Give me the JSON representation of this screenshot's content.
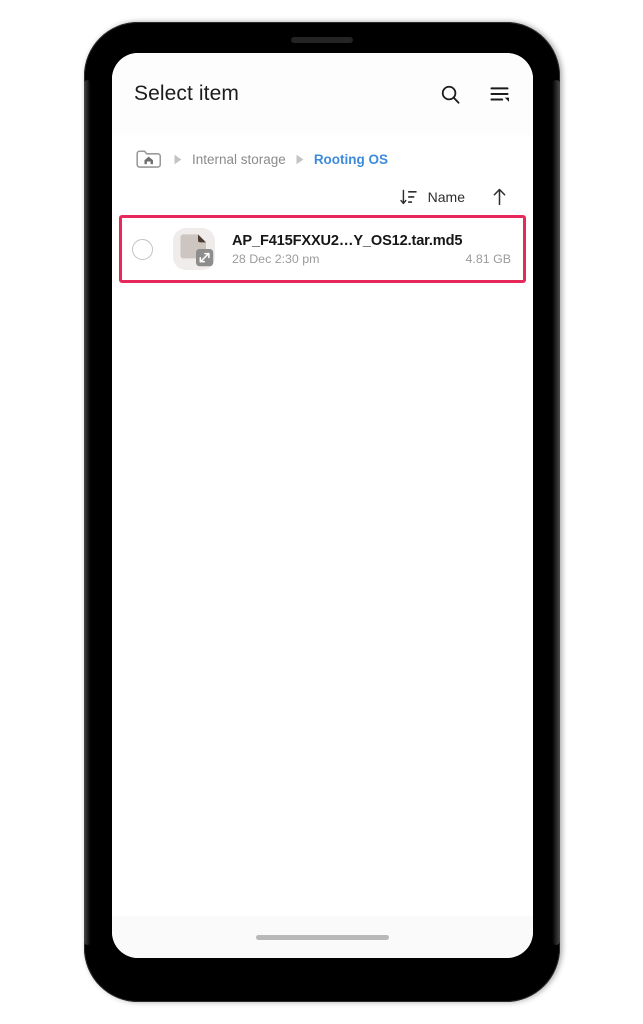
{
  "app": {
    "title": "Select item"
  },
  "header": {
    "search_icon": "search-icon",
    "menu_icon": "sort-list-menu-icon"
  },
  "breadcrumb": {
    "home_icon": "home-folder-icon",
    "separator_icon": "chevron-right-icon",
    "items": [
      {
        "label": "Internal storage",
        "active": false
      },
      {
        "label": "Rooting OS",
        "active": true
      }
    ]
  },
  "sort_bar": {
    "sort_icon": "sort-descending-icon",
    "label": "Name",
    "direction_icon": "arrow-up-icon"
  },
  "file_list": {
    "items": [
      {
        "name": "AP_F415FXXU2…Y_OS12.tar.md5",
        "date": "28 Dec 2:30 pm",
        "size": "4.81 GB",
        "selected": false,
        "icon": "archive-file-icon",
        "badge_icon": "extract-arrows-icon",
        "highlighted": true
      }
    ]
  },
  "colors": {
    "highlight_border": "#e6285a",
    "breadcrumb_active": "#3d8bdb",
    "breadcrumb_inactive": "#8b8b8b",
    "file_icon_paper": "#cdc6c0",
    "file_icon_fold": "#4a3c33",
    "badge_gray": "#8d8d8d",
    "title_text": "#1c1c1c"
  },
  "system": {
    "gesture_handle": "gesture-handle"
  }
}
